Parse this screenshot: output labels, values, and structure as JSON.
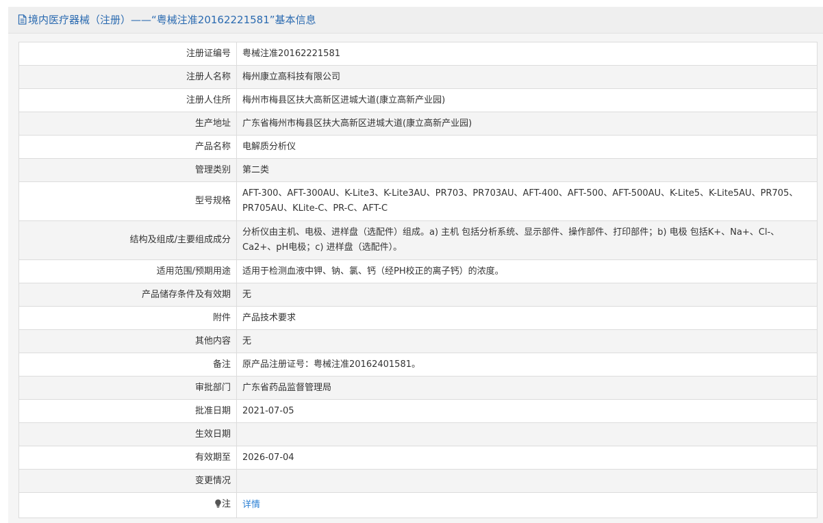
{
  "title": "境内医疗器械（注册）——“粤械注准20162221581”基本信息",
  "rows": [
    {
      "label": "注册证编号",
      "value": "粤械注准20162221581"
    },
    {
      "label": "注册人名称",
      "value": "梅州康立高科技有限公司"
    },
    {
      "label": "注册人住所",
      "value": "梅州市梅县区扶大高新区进城大道(康立高新产业园)"
    },
    {
      "label": "生产地址",
      "value": "广东省梅州市梅县区扶大高新区进城大道(康立高新产业园)"
    },
    {
      "label": "产品名称",
      "value": "电解质分析仪"
    },
    {
      "label": "管理类别",
      "value": "第二类"
    },
    {
      "label": "型号规格",
      "value": "AFT-300、AFT-300AU、K-Lite3、K-Lite3AU、PR703、PR703AU、AFT-400、AFT-500、AFT-500AU、K-Lite5、K-Lite5AU、PR705、PR705AU、KLite-C、PR-C、AFT-C"
    },
    {
      "label": "结构及组成/主要组成成分",
      "value": "分析仪由主机、电极、进样盘（选配件）组成。a) 主机 包括分析系统、显示部件、操作部件、打印部件；b) 电极 包括K+、Na+、Cl-、Ca2+、pH电极；c) 进样盘（选配件）。"
    },
    {
      "label": "适用范围/预期用途",
      "value": "适用于检测血液中钾、钠、氯、钙（经PH校正的离子钙）的浓度。"
    },
    {
      "label": "产品储存条件及有效期",
      "value": "无"
    },
    {
      "label": "附件",
      "value": "产品技术要求"
    },
    {
      "label": "其他内容",
      "value": "无"
    },
    {
      "label": "备注",
      "value": "原产品注册证号：粤械注准20162401581。"
    },
    {
      "label": "审批部门",
      "value": "广东省药品监督管理局"
    },
    {
      "label": "批准日期",
      "value": "2021-07-05"
    },
    {
      "label": "生效日期",
      "value": ""
    },
    {
      "label": "有效期至",
      "value": "2026-07-04"
    },
    {
      "label": "变更情况",
      "value": ""
    }
  ],
  "note_row": {
    "icon": "lightbulb-icon",
    "label": "注",
    "link": "详情"
  },
  "colors": {
    "title": "#2a6ab0",
    "link": "#2a7fd4",
    "alt_row": "#f4f4f4",
    "border": "#dcdcdc"
  }
}
